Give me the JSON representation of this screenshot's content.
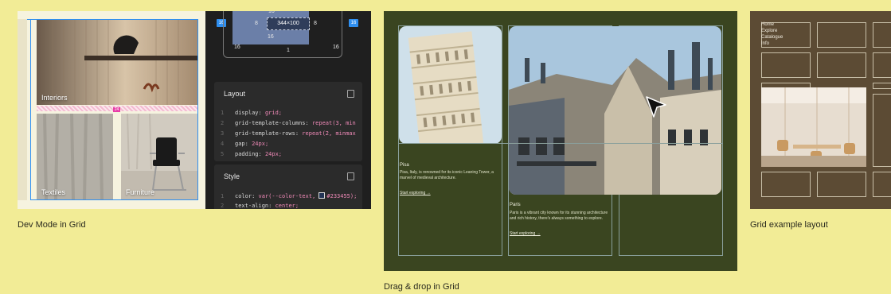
{
  "cards": [
    {
      "caption": "Dev Mode in Grid",
      "photos": [
        {
          "label": "Interiors"
        },
        {
          "label": "Textiles"
        },
        {
          "label": "Furniture"
        }
      ],
      "gap_badge": "24",
      "box_model": {
        "top": "16",
        "content": "344×100",
        "left_pad": "8",
        "right_pad": "8",
        "bottom_pad": "16",
        "bottom": "1",
        "corner_left": "16",
        "corner_right": "16",
        "outer_left": "16",
        "outer_right": "16"
      },
      "layout_panel": {
        "title": "Layout",
        "lines": [
          {
            "n": "1",
            "prop": "display",
            "value": "grid;"
          },
          {
            "n": "2",
            "prop": "grid-template-columns",
            "value": "repeat(3, min"
          },
          {
            "n": "3",
            "prop": "grid-template-rows",
            "value": "repeat(2, minmax"
          },
          {
            "n": "4",
            "prop": "gap",
            "value": "24px;"
          },
          {
            "n": "5",
            "prop": "padding",
            "value": "24px;"
          }
        ]
      },
      "style_panel": {
        "title": "Style",
        "lines": [
          {
            "n": "1",
            "prop": "color",
            "value": "var(--color-text,",
            "hex": "#233455);"
          },
          {
            "n": "2",
            "prop": "text-align",
            "value": "center;"
          }
        ],
        "swatch_color": "#233455"
      }
    },
    {
      "caption": "Drag & drop in Grid",
      "cities": [
        {
          "title": "Pisa",
          "desc": "Pisa, Italy, is renowned for its iconic Leaning Tower, a marvel of medieval architecture.",
          "link": "Start exploring →"
        },
        {
          "title": "Paris",
          "desc": "Paris is a vibrant city known for its stunning architecture and rich history, there's always something to explore.",
          "link": "Start exploring →"
        }
      ]
    },
    {
      "caption": "Grid example layout",
      "menu": [
        "Home",
        "Explore",
        "Catalogue",
        "Info"
      ]
    }
  ],
  "colors": {
    "background": "#f2ec96",
    "dev_panel": "#1f1f1f",
    "drag_bg": "#3a4520",
    "example_bg": "#5c4b34",
    "selection": "#2f8ff0",
    "accent_pink": "#e83ea7"
  }
}
